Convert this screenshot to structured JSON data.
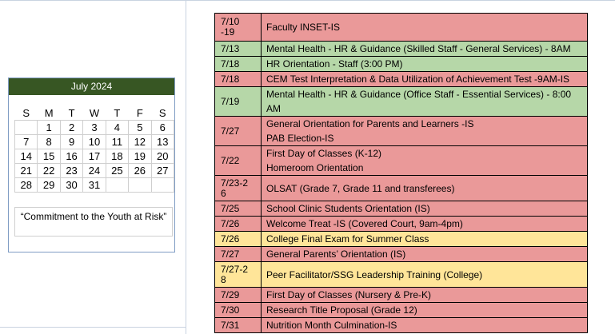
{
  "colors": {
    "calendar_header": "#375623",
    "event_red": "#ea9999",
    "event_green": "#b6d7a8",
    "event_yellow": "#ffe599"
  },
  "calendar": {
    "title": "July 2024",
    "weekdays": [
      "S",
      "M",
      "T",
      "W",
      "T",
      "F",
      "S"
    ],
    "weeks": [
      [
        "",
        "1",
        "2",
        "3",
        "4",
        "5",
        "6"
      ],
      [
        "7",
        "8",
        "9",
        "10",
        "11",
        "12",
        "13"
      ],
      [
        "14",
        "15",
        "16",
        "17",
        "18",
        "19",
        "20"
      ],
      [
        "21",
        "22",
        "23",
        "24",
        "25",
        "26",
        "27"
      ],
      [
        "28",
        "29",
        "30",
        "31",
        "",
        "",
        ""
      ]
    ],
    "motto": "“Commitment to the Youth at Risk”"
  },
  "events": [
    {
      "date": "7/10 -19",
      "lines": [
        "Faculty INSET-IS"
      ],
      "color": "red"
    },
    {
      "date": "7/13",
      "lines": [
        "Mental Health - HR & Guidance (Skilled Staff - General Services) - 8AM"
      ],
      "color": "green"
    },
    {
      "date": "7/18",
      "lines": [
        "HR Orientation - Staff (3:00 PM)"
      ],
      "color": "green"
    },
    {
      "date": "7/18",
      "lines": [
        "CEM Test Interpretation & Data Utilization of Achievement Test -9AM-IS"
      ],
      "color": "red"
    },
    {
      "date": "7/19",
      "lines": [
        "Mental Health - HR & Guidance (Office Staff - Essential Services) - 8:00 AM"
      ],
      "color": "green"
    },
    {
      "date": "7/27",
      "lines": [
        "General Orientation for Parents and Learners -IS",
        "PAB Election-IS"
      ],
      "color": "red"
    },
    {
      "date": "7/22",
      "lines": [
        "First Day of Classes (K-12)",
        "Homeroom Orientation"
      ],
      "color": "red"
    },
    {
      "date": "7/23-2 6",
      "lines": [
        "OLSAT (Grade 7, Grade 11 and transferees)"
      ],
      "color": "red"
    },
    {
      "date": "7/25",
      "lines": [
        "School Clinic Students Orientation (IS)"
      ],
      "color": "red"
    },
    {
      "date": "7/26",
      "lines": [
        "Welcome Treat -IS (Covered Court, 9am-4pm)"
      ],
      "color": "red"
    },
    {
      "date": "7/26",
      "lines": [
        "College Final Exam for Summer Class"
      ],
      "color": "yellow"
    },
    {
      "date": "7/27",
      "lines": [
        "General Parents’ Orientation (IS)"
      ],
      "color": "red"
    },
    {
      "date": "7/27-2 8",
      "lines": [
        "Peer Facilitator/SSG Leadership Training (College)"
      ],
      "color": "yellow"
    },
    {
      "date": "7/29",
      "lines": [
        "First Day of Classes (Nursery & Pre-K)"
      ],
      "color": "red"
    },
    {
      "date": "7/30",
      "lines": [
        "Research Title Proposal (Grade 12)"
      ],
      "color": "red"
    },
    {
      "date": "7/31",
      "lines": [
        "Nutrition Month Culmination-IS"
      ],
      "color": "red"
    }
  ]
}
